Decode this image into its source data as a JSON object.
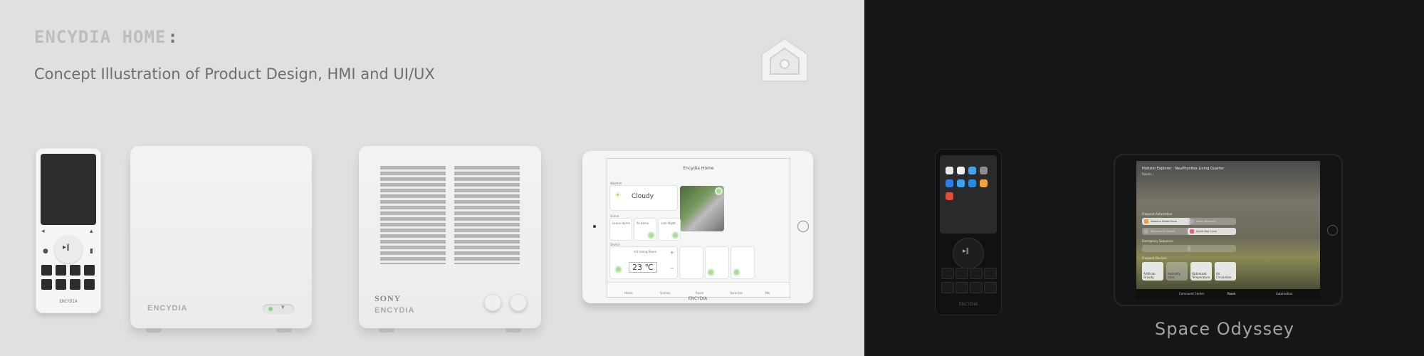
{
  "brand": {
    "name": "ENCYDIA HOME",
    "colon": ":"
  },
  "subtitle": "Concept Illustration of Product Design, HMI and UI/UX",
  "remote": {
    "label": "ENCYDIA"
  },
  "speaker_plain": {
    "label": "ENCYDIA"
  },
  "speaker_sony": {
    "sony": "SONY",
    "label": "ENCYDIA"
  },
  "tablet": {
    "title": "Encydia Home",
    "weather_section": "Weather",
    "weather": "Cloudy",
    "scene_section": "Scene",
    "scenes": [
      "Leave Home",
      "At Home",
      "Late Night"
    ],
    "device_section": "Device",
    "device_name": "LG Living Room",
    "temperature": "23 ℃",
    "nav": [
      "Home",
      "Scenes",
      "Room",
      "Favorites",
      "Me"
    ],
    "brand": "ENCYDIA"
  },
  "phone": {
    "label": "ENCYDIA"
  },
  "dark_tablet": {
    "title": "Horizon Explorer · NeuPhynitex Living Quarter",
    "subtitle": "Rooms ›",
    "frequent_section": "Frequent Automation",
    "frequent": [
      "Seasons Global Zone",
      "Lobby Recovery",
      "Welcome to Station",
      "Synth Day Cycle"
    ],
    "emergency_section": "Emergency Sequence",
    "common_section": "Frequent Devices",
    "devices": [
      "Artificial Gravity",
      "Humidity Core",
      "Optimized Temperature",
      "Air Circulation"
    ],
    "nav": [
      "Command Center",
      "Room",
      "Automation"
    ]
  },
  "caption": "Space Odyssey",
  "colors": {
    "left_bg": "#e0e0e1",
    "right_bg": "#161616",
    "accent_green": "#7fd87a"
  }
}
